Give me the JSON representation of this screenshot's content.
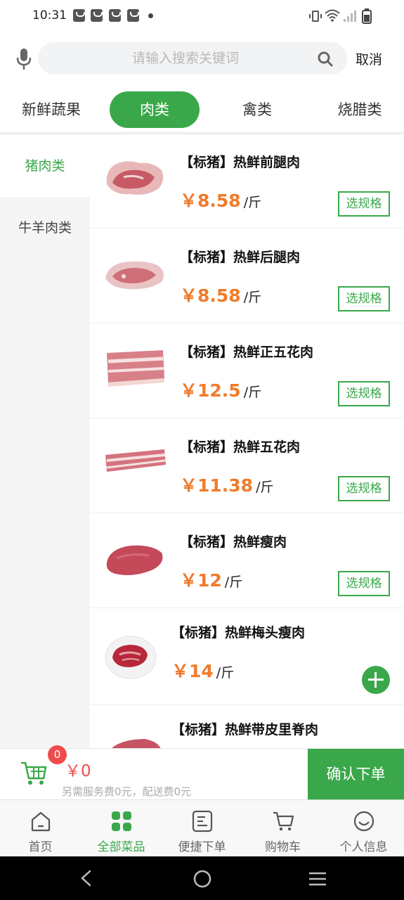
{
  "status_bar": {
    "time": "10:31"
  },
  "search": {
    "placeholder": "请输入搜索关键词",
    "cancel_label": "取消"
  },
  "tabs": [
    {
      "label": "新鲜蔬果",
      "active": false
    },
    {
      "label": "肉类",
      "active": true
    },
    {
      "label": "禽类",
      "active": false
    },
    {
      "label": "烧腊类",
      "active": false
    }
  ],
  "sidebar": {
    "items": [
      {
        "label": "猪肉类",
        "active": true
      },
      {
        "label": "牛羊肉类",
        "active": false
      }
    ]
  },
  "products": [
    {
      "name": "【标猪】热鲜前腿肉",
      "price": "￥8.58",
      "unit": "/斤",
      "action": "选规格"
    },
    {
      "name": "【标猪】热鲜后腿肉",
      "price": "￥8.58",
      "unit": "/斤",
      "action": "选规格"
    },
    {
      "name": "【标猪】热鲜正五花肉",
      "price": "￥12.5",
      "unit": "/斤",
      "action": "选规格"
    },
    {
      "name": "【标猪】热鲜五花肉",
      "price": "￥11.38",
      "unit": "/斤",
      "action": "选规格"
    },
    {
      "name": "【标猪】热鲜瘦肉",
      "price": "￥12",
      "unit": "/斤",
      "action": "选规格"
    },
    {
      "name": "【标猪】热鲜梅头瘦肉",
      "price": "￥14",
      "unit": "/斤",
      "action": "add"
    },
    {
      "name": "【标猪】热鲜带皮里脊肉",
      "price": "",
      "unit": "",
      "action": ""
    }
  ],
  "cart": {
    "count": "0",
    "total": "￥0",
    "fee_text": "另需服务费0元，配送费0元",
    "confirm_label": "确认下单"
  },
  "bottom_nav": [
    {
      "label": "首页",
      "icon": "home-icon",
      "active": false
    },
    {
      "label": "全部菜品",
      "icon": "grid-icon",
      "active": true
    },
    {
      "label": "便捷下单",
      "icon": "list-icon",
      "active": false
    },
    {
      "label": "购物车",
      "icon": "cart-icon",
      "active": false
    },
    {
      "label": "个人信息",
      "icon": "smile-icon",
      "active": false
    }
  ],
  "colors": {
    "accent": "#3aa84a",
    "price": "#f07b2c",
    "badge": "#f04b4b"
  }
}
